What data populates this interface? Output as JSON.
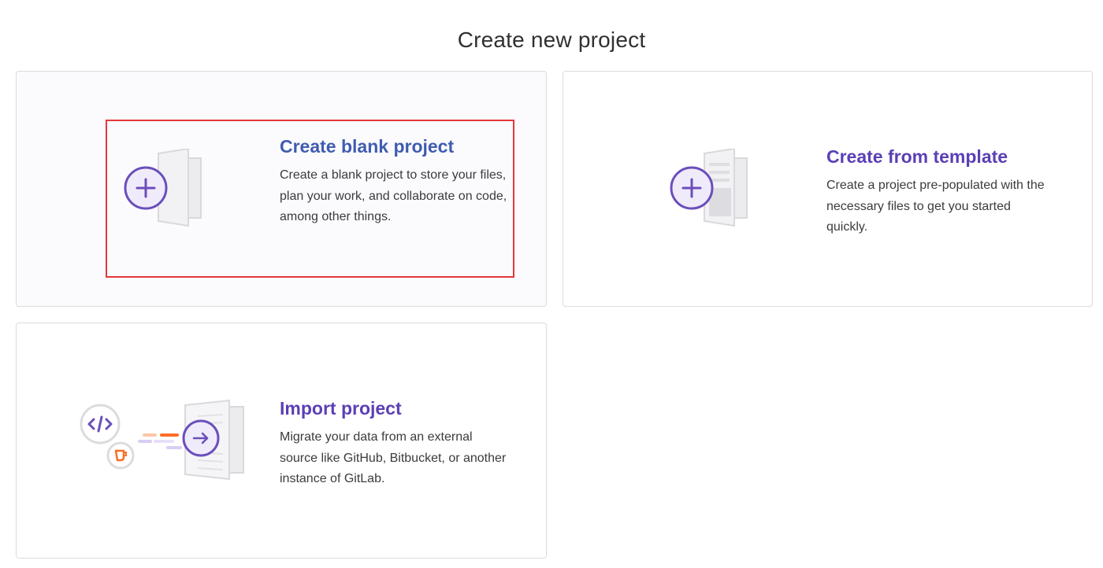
{
  "page": {
    "title": "Create new project"
  },
  "cards": [
    {
      "id": "blank",
      "heading": "Create blank project",
      "description": "Create a blank project to store your files, plan your work, and collaborate on code, among other things.",
      "icon": "blank-project-icon",
      "highlighted": true
    },
    {
      "id": "template",
      "heading": "Create from template",
      "description": "Create a project pre-populated with the necessary files to get you started quickly.",
      "icon": "template-project-icon",
      "highlighted": false
    },
    {
      "id": "import",
      "heading": "Import project",
      "description": "Migrate your data from an external source like GitHub, Bitbucket, or another instance of GitLab.",
      "icon": "import-project-icon",
      "highlighted": false
    }
  ],
  "colors": {
    "accent_purple": "#6b4fbb",
    "heading_blue": "#3f5cb0",
    "highlight_red": "#e5373a",
    "import_orange": "#fc6d26",
    "card_border": "#dcdcde"
  }
}
